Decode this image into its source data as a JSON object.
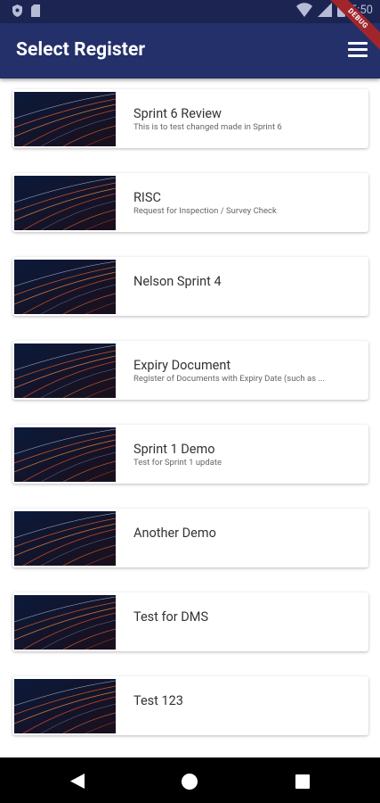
{
  "status_bar": {
    "time": "5:50"
  },
  "app_bar": {
    "title": "Select Register",
    "debug_label": "DEBUG"
  },
  "registers": [
    {
      "name": "Sprint 6 Review",
      "description": "This is to test changed made in Sprint 6"
    },
    {
      "name": "RISC",
      "description": "Request for Inspection / Survey Check"
    },
    {
      "name": "Nelson Sprint 4",
      "description": ""
    },
    {
      "name": "Expiry Document",
      "description": "Register of Documents with Expiry Date (such as ..."
    },
    {
      "name": "Sprint 1 Demo",
      "description": "Test for Sprint 1 update"
    },
    {
      "name": "Another Demo",
      "description": ""
    },
    {
      "name": "Test for DMS",
      "description": ""
    },
    {
      "name": "Test 123",
      "description": ""
    }
  ],
  "colors": {
    "app_bar": "#23306a",
    "status_bar": "#1c2452",
    "nav_bar": "#000000"
  }
}
